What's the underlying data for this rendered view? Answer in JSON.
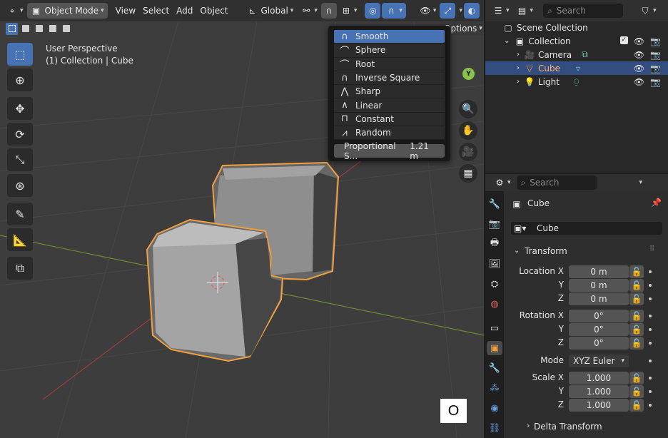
{
  "viewport": {
    "header": {
      "mode": "Object Mode",
      "menus": [
        "View",
        "Select",
        "Add",
        "Object"
      ],
      "orientation": "Global",
      "options": "Options"
    },
    "info_line1": "User Perspective",
    "info_line2": "(1) Collection | Cube",
    "gizmo_y": "Y",
    "key_overlay": "O"
  },
  "falloff_menu": {
    "items": [
      "Smooth",
      "Sphere",
      "Root",
      "Inverse Square",
      "Sharp",
      "Linear",
      "Constant",
      "Random"
    ],
    "selected": "Smooth",
    "proportional_label": "Proportional S...",
    "proportional_value": "1.21 m"
  },
  "outliner": {
    "search_placeholder": "Search",
    "scene_collection": "Scene Collection",
    "collection": "Collection",
    "objects": [
      {
        "name": "Camera",
        "selected": false
      },
      {
        "name": "Cube",
        "selected": true
      },
      {
        "name": "Light",
        "selected": false
      }
    ]
  },
  "properties": {
    "search_placeholder": "Search",
    "object_name": "Cube",
    "object_field": "Cube",
    "transform_title": "Transform",
    "location_label": "Location X",
    "rotation_label": "Rotation X",
    "scale_label": "Scale X",
    "axis_y": "Y",
    "axis_z": "Z",
    "location": [
      "0 m",
      "0 m",
      "0 m"
    ],
    "rotation": [
      "0°",
      "0°",
      "0°"
    ],
    "mode_label": "Mode",
    "mode_value": "XYZ Euler",
    "scale": [
      "1.000",
      "1.000",
      "1.000"
    ],
    "delta_title": "Delta Transform"
  },
  "colors": {
    "accent": "#4772b3",
    "selection_outline": "#f0a040",
    "x_axis": "#c0504d",
    "y_axis": "#8bb33a"
  }
}
